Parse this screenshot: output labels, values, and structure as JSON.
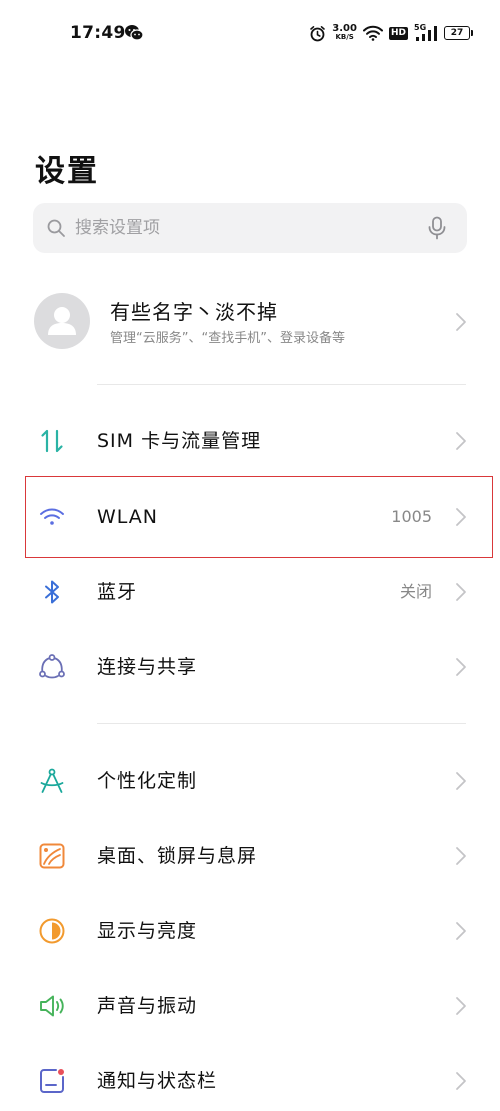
{
  "status_bar": {
    "time": "17:49",
    "net_speed_value": "3.00",
    "net_speed_unit": "KB/S",
    "hd_label": "HD",
    "network_type": "5G",
    "battery_level": "27",
    "icons": [
      "wechat-icon",
      "alarm-icon",
      "wifi-icon",
      "signal-icon",
      "battery-icon"
    ]
  },
  "page": {
    "title": "设置"
  },
  "search": {
    "placeholder": "搜索设置项",
    "value": ""
  },
  "account": {
    "name": "有些名字丶淡不掉",
    "description": "管理“云服务”、“查找手机”、登录设备等"
  },
  "settings": {
    "sim": {
      "label": "SIM 卡与流量管理",
      "value": ""
    },
    "wlan": {
      "label": "WLAN",
      "value": "1005"
    },
    "bluetooth": {
      "label": "蓝牙",
      "value": "关闭"
    },
    "connection": {
      "label": "连接与共享",
      "value": ""
    },
    "personalization": {
      "label": "个性化定制",
      "value": ""
    },
    "desktop": {
      "label": "桌面、锁屏与息屏",
      "value": ""
    },
    "display": {
      "label": "显示与亮度",
      "value": ""
    },
    "sound": {
      "label": "声音与振动",
      "value": ""
    },
    "notification": {
      "label": "通知与状态栏",
      "value": ""
    }
  },
  "colors": {
    "sim_icon": "#2ab3a5",
    "wlan_icon": "#5b6ee1",
    "bluetooth_icon": "#3a6fd8",
    "connection_icon": "#6a6fb5",
    "personalization_icon": "#1aa89b",
    "desktop_icon": "#f0883a",
    "display_icon": "#f29a2e",
    "sound_icon": "#45b35a",
    "notification_icon": "#5b66c9",
    "highlight": "#d9383a"
  }
}
